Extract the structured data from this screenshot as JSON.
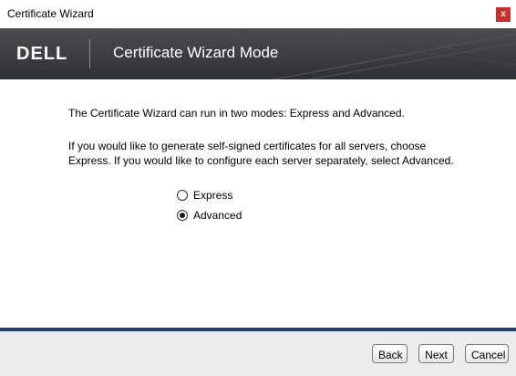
{
  "window": {
    "title": "Certificate Wizard",
    "close_label": "x"
  },
  "banner": {
    "logo_text": "DELL",
    "title": "Certificate Wizard Mode"
  },
  "content": {
    "paragraph1": "The Certificate Wizard can run in two modes: Express and Advanced.",
    "paragraph2_line1": "If you would like to generate self-signed certificates for all servers, choose",
    "paragraph2_line2": "Express. If you would like to configure each server separately, select Advanced.",
    "options": [
      {
        "label": "Express",
        "selected": false
      },
      {
        "label": "Advanced",
        "selected": true
      }
    ]
  },
  "footer": {
    "back_label": "Back",
    "next_label": "Next",
    "cancel_label": "Cancel"
  },
  "colors": {
    "accent_bar": "#1e3f82",
    "close_button": "#c9302c",
    "banner_dark": "#3b3d40"
  }
}
